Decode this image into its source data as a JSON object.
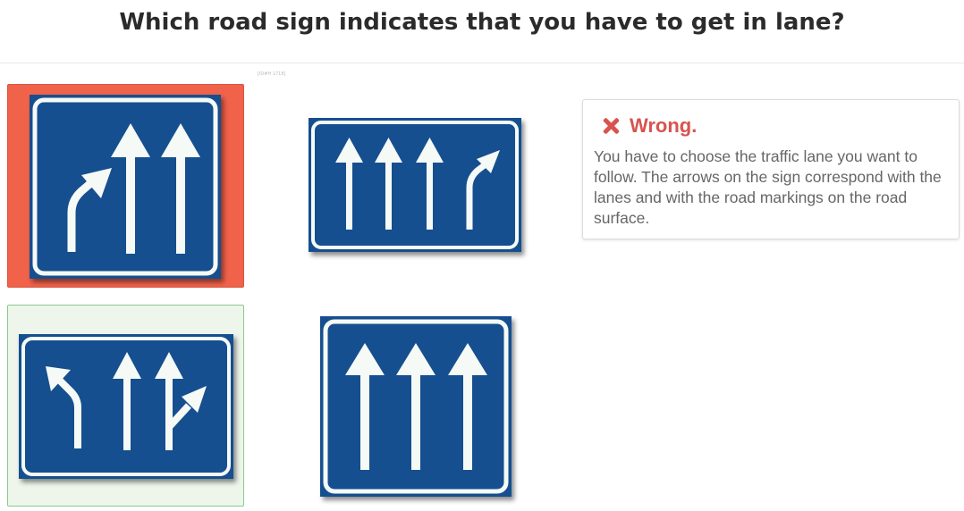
{
  "question": "Which road sign indicates that you have to get in lane?",
  "tiny_tag": "[ID#H 1718]",
  "options": [
    {
      "state": "wrong-selected",
      "sign": "two-lanes-right-turn-arrow-plus-two-straight",
      "color": "#f1624a"
    },
    {
      "state": "neutral",
      "sign": "three-straight-plus-right-turn-lane-wide"
    },
    {
      "state": "correct",
      "sign": "left-turn-two-straight-one-right-split",
      "color": "#eef6ec"
    },
    {
      "state": "neutral",
      "sign": "three-straight-lanes"
    }
  ],
  "feedback": {
    "title": "Wrong.",
    "text": "You have to choose the traffic lane you want to follow. The arrows on the sign correspond with the lanes and with the road markings on the road surface.",
    "title_color": "#d9534f"
  },
  "colors": {
    "sign_blue": "#154f8f",
    "arrow_white": "#f6faf6"
  }
}
